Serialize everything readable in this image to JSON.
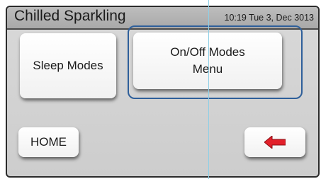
{
  "header": {
    "title": "Chilled Sparkling",
    "datetime": "10:19 Tue 3, Dec 3013"
  },
  "menu": {
    "sleep_modes_label": "Sleep Modes",
    "onoff_modes_label": "On/Off Modes Menu"
  },
  "footer": {
    "home_label": "HOME",
    "back_icon": "left-arrow-icon"
  },
  "colors": {
    "selection_border": "#2e5f9a",
    "back_arrow": "#e2202a"
  }
}
